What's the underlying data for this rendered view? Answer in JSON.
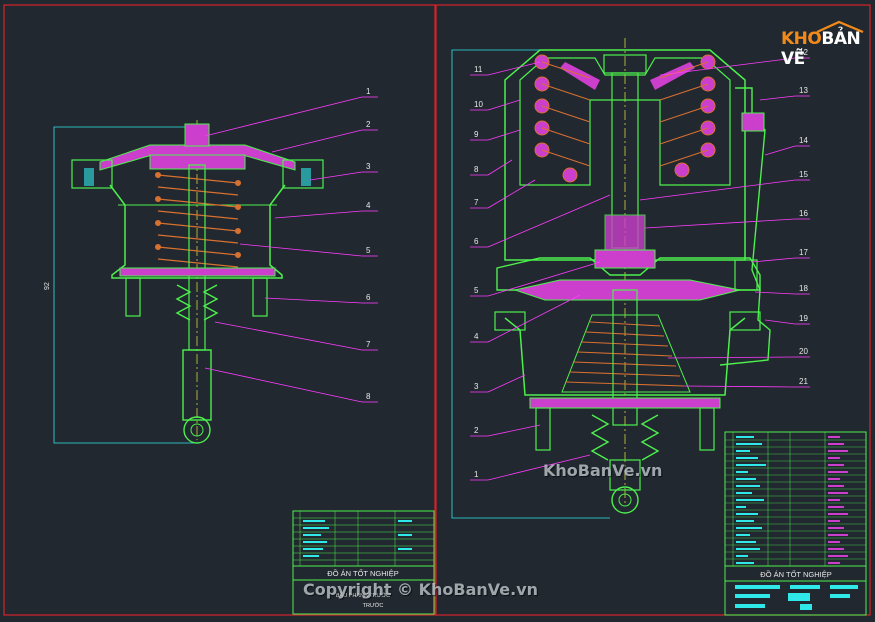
{
  "left_drawing": {
    "callouts": [
      "1",
      "2",
      "3",
      "4",
      "5",
      "6",
      "7",
      "8"
    ],
    "dimension_label": "92"
  },
  "right_drawing": {
    "callouts_left": [
      "11",
      "10",
      "9",
      "8",
      "7",
      "6",
      "5",
      "4",
      "3",
      "2",
      "1"
    ],
    "callouts_right": [
      "12",
      "13",
      "14",
      "15",
      "16",
      "17",
      "18",
      "19",
      "20",
      "21"
    ]
  },
  "title_block_left": {
    "project_title": "ĐỒ ÁN TỐT NGHIỆP",
    "subtitle": "BẦU PHANH TRƯỚC",
    "sheet_label": "TRƯỚC"
  },
  "title_block_right": {
    "project_title": "ĐỒ ÁN TỐT NGHIỆP"
  },
  "watermarks": {
    "center": "KhoBanVe.vn",
    "bottom": "Copyright © KhoBanVe.vn"
  },
  "logo": {
    "text_a": "KHO",
    "text_b": "BẢN VẼ"
  },
  "colors": {
    "background": "#212830",
    "frame": "#d8232a",
    "outline": "#4df04d",
    "hatch": "#cc3fcc",
    "leader": "#ff3cff",
    "spring": "#d87030",
    "extension": "#2fe8e8",
    "centerline": "#e8e83a",
    "text": "#e8e8e8"
  }
}
